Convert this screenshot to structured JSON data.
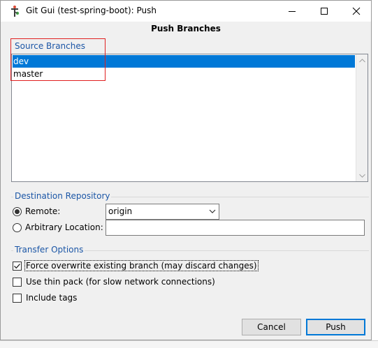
{
  "window": {
    "title": "Git Gui (test-spring-boot): Push",
    "icon": "git-gui-icon",
    "controls": [
      "minimize-icon",
      "maximize-icon",
      "close-icon"
    ]
  },
  "heading": "Push Branches",
  "source_branches": {
    "label": "Source Branches",
    "items": [
      {
        "name": "dev",
        "selected": true
      },
      {
        "name": "master",
        "selected": false
      }
    ]
  },
  "destination": {
    "label": "Destination Repository",
    "remote_label": "Remote:",
    "remote_checked": true,
    "remote_value": "origin",
    "arbitrary_label": "Arbitrary Location:",
    "arbitrary_checked": false,
    "arbitrary_value": ""
  },
  "transfer": {
    "label": "Transfer Options",
    "options": [
      {
        "label": "Force overwrite existing branch (may discard changes)",
        "checked": true
      },
      {
        "label": "Use thin pack (for slow network connections)",
        "checked": false
      },
      {
        "label": "Include tags",
        "checked": false
      }
    ]
  },
  "buttons": {
    "cancel": "Cancel",
    "push": "Push"
  },
  "colors": {
    "selection": "#0078d7",
    "group_label": "#1b56a6",
    "annotation_box": "#e02020"
  }
}
